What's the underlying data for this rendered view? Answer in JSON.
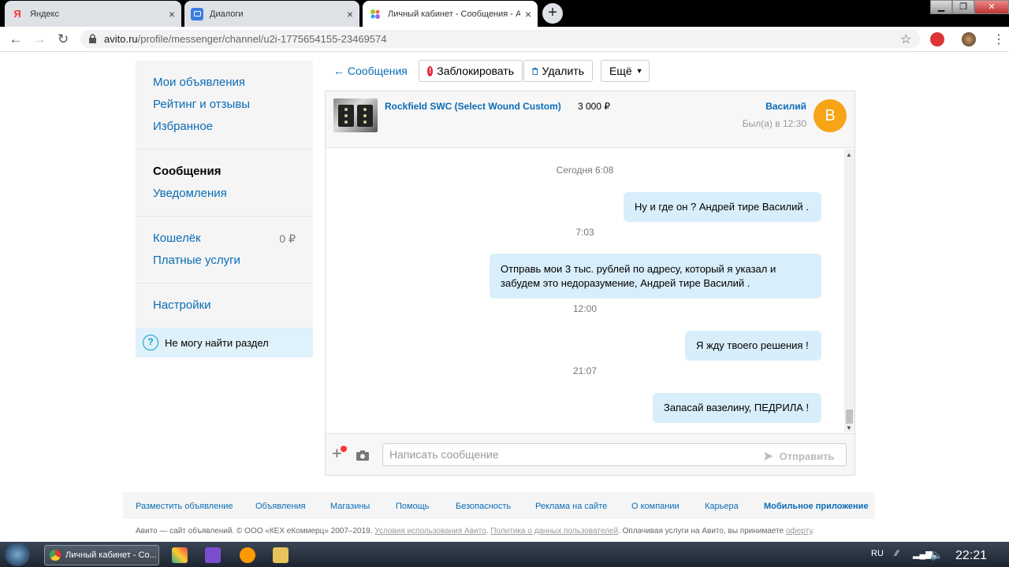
{
  "browser": {
    "tabs": [
      {
        "title": "Яндекс",
        "close": "×"
      },
      {
        "title": "Диалоги",
        "close": "×"
      },
      {
        "title": "Личный кабинет - Сообщения - Ави",
        "close": "×"
      }
    ],
    "new_tab": "+",
    "url_host": "avito.ru",
    "url_path": "/profile/messenger/channel/u2i-1775654155-23469574",
    "window_controls": {
      "min": "▁",
      "max": "❐",
      "close": "✕"
    }
  },
  "sidebar": {
    "group1": [
      "Мои объявления",
      "Рейтинг и отзывы",
      "Избранное"
    ],
    "group2_active": "Сообщения",
    "group2": [
      "Уведомления"
    ],
    "wallet_label": "Кошелёк",
    "wallet_value": "0 ₽",
    "paid": "Платные услуги",
    "settings": "Настройки",
    "help": "Не могу найти раздел",
    "help_icon": "?"
  },
  "topbar": {
    "back": "← Сообщения",
    "block": "Заблокировать",
    "delete": "Удалить",
    "more": "Ещё"
  },
  "chat_header": {
    "item_title": "Rockfield SWC (Select Wound Custom)",
    "price": "3 000 ₽",
    "user_name": "Василий",
    "last_seen": "Был(а) в 12:30",
    "avatar_letter": "В",
    "avatar_color": "#f7a516"
  },
  "messages": [
    {
      "time": "Сегодня 6:08",
      "text": "Ну и где он ? Андрей тире Василий ."
    },
    {
      "time": "7:03",
      "text": "Отправь мои 3 тыс. рублей по адресу, который я указал и забудем это недоразумение, Андрей тире Василий ."
    },
    {
      "time": "12:00",
      "text": "Я жду твоего решения !"
    },
    {
      "time": "21:07",
      "text": "Запасай вазелину, ПЕДРИЛА !"
    }
  ],
  "composer": {
    "placeholder": "Написать сообщение",
    "send": "Отправить"
  },
  "footer": {
    "links": [
      "Разместить объявление",
      "Объявления",
      "Магазины",
      "Помощь",
      "Безопасность",
      "Реклама на сайте",
      "О компании",
      "Карьера",
      "Мобильное приложение"
    ],
    "copyright": "Авито — сайт объявлений. © ООО «КЕХ еКоммерц» 2007–2019.",
    "terms": "Условия использования Авито",
    "policy": "Политика о данных пользователей",
    "paying": "Оплачивая услуги на Авито, вы принимаете",
    "offer": "оферту"
  },
  "taskbar": {
    "task": "Личный кабинет - Со...",
    "lang": "RU",
    "clock": "22:21"
  },
  "colors": {
    "link": "#0a6cb6",
    "bubble": "#d8eefa",
    "accent_orange": "#f7a516"
  }
}
